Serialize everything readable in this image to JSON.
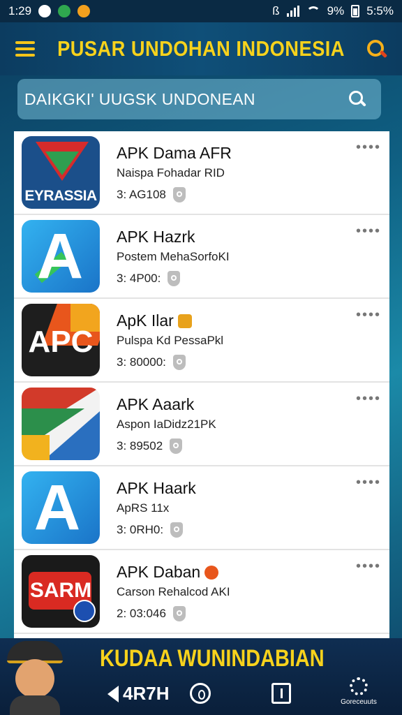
{
  "status": {
    "time": "1:29",
    "battery_text": "9%",
    "right_text": "5:5%"
  },
  "header": {
    "title": "PUSAR UNDOHAN INDONESIA"
  },
  "search": {
    "text": "DAIKGKI' UUGSK UNDONEAN"
  },
  "apps": [
    {
      "name": "APK Dama AFR",
      "subtitle": "Naispa Fohadar RID",
      "size": "3: AG108",
      "icon_label": "EYRASSIA"
    },
    {
      "name": "APK Hazrk",
      "subtitle": "Postem MehaSorfoKI",
      "size": "3: 4P00:",
      "icon_label": "A"
    },
    {
      "name": "ApK Ilar",
      "subtitle": "Pulspa Kd PessaPkl",
      "size": "3: 80000:",
      "icon_label": "APC"
    },
    {
      "name": "APK Aaark",
      "subtitle": "Aspon IaDidz21PK",
      "size": "3: 89502",
      "icon_label": ""
    },
    {
      "name": "APK Haark",
      "subtitle": "ApRS 11x",
      "size": "3: 0RH0:",
      "icon_label": "A"
    },
    {
      "name": "APK Daban",
      "subtitle": "Carson Rehalcod AKI",
      "size": "2: 03:046",
      "icon_label": "SARM"
    }
  ],
  "banner": {
    "title": "KUDAA WUNINDABIAN"
  },
  "nav": {
    "back_label": "4R7H",
    "settings_label": "Goreceuuts"
  },
  "colors": {
    "accent": "#f7d21c",
    "header_bg": "#0c3c60",
    "list_bg": "#ffffff"
  }
}
